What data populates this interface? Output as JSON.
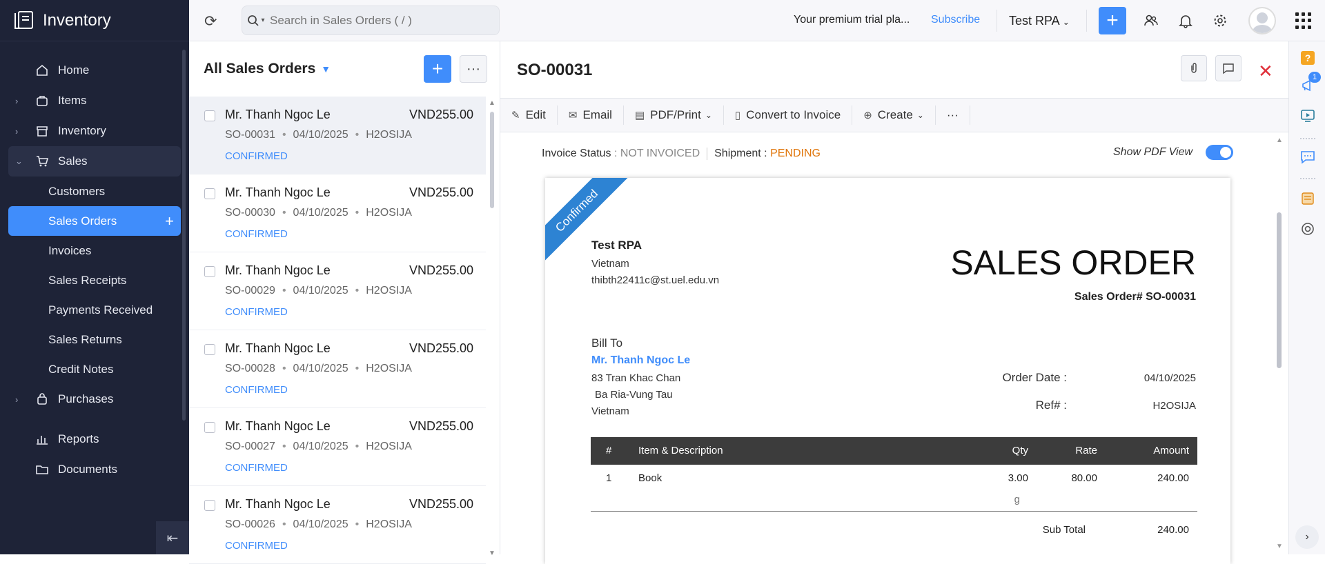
{
  "app": {
    "name": "Inventory"
  },
  "sidebar": {
    "items": [
      {
        "label": "Home"
      },
      {
        "label": "Items"
      },
      {
        "label": "Inventory"
      },
      {
        "label": "Sales"
      },
      {
        "label": "Purchases"
      },
      {
        "label": "Reports"
      },
      {
        "label": "Documents"
      }
    ],
    "sales_sub": [
      {
        "label": "Customers"
      },
      {
        "label": "Sales Orders"
      },
      {
        "label": "Invoices"
      },
      {
        "label": "Sales Receipts"
      },
      {
        "label": "Payments Received"
      },
      {
        "label": "Sales Returns"
      },
      {
        "label": "Credit Notes"
      }
    ]
  },
  "topbar": {
    "search_placeholder": "Search in Sales Orders ( / )",
    "trial_text": "Your premium trial pla...",
    "subscribe": "Subscribe",
    "org": "Test RPA"
  },
  "list": {
    "title": "All Sales Orders",
    "rows": [
      {
        "name": "Mr. Thanh Ngoc Le",
        "amount": "VND255.00",
        "number": "SO-00031",
        "date": "04/10/2025",
        "ref": "H2OSIJA",
        "status": "CONFIRMED"
      },
      {
        "name": "Mr. Thanh Ngoc Le",
        "amount": "VND255.00",
        "number": "SO-00030",
        "date": "04/10/2025",
        "ref": "H2OSIJA",
        "status": "CONFIRMED"
      },
      {
        "name": "Mr. Thanh Ngoc Le",
        "amount": "VND255.00",
        "number": "SO-00029",
        "date": "04/10/2025",
        "ref": "H2OSIJA",
        "status": "CONFIRMED"
      },
      {
        "name": "Mr. Thanh Ngoc Le",
        "amount": "VND255.00",
        "number": "SO-00028",
        "date": "04/10/2025",
        "ref": "H2OSIJA",
        "status": "CONFIRMED"
      },
      {
        "name": "Mr. Thanh Ngoc Le",
        "amount": "VND255.00",
        "number": "SO-00027",
        "date": "04/10/2025",
        "ref": "H2OSIJA",
        "status": "CONFIRMED"
      },
      {
        "name": "Mr. Thanh Ngoc Le",
        "amount": "VND255.00",
        "number": "SO-00026",
        "date": "04/10/2025",
        "ref": "H2OSIJA",
        "status": "CONFIRMED"
      }
    ]
  },
  "detail": {
    "title": "SO-00031",
    "toolbar": {
      "edit": "Edit",
      "email": "Email",
      "pdf": "PDF/Print",
      "convert": "Convert to Invoice",
      "create": "Create"
    },
    "invoice_status_label": "Invoice Status",
    "invoice_status": "NOT INVOICED",
    "shipment_label": "Shipment",
    "shipment_status": "PENDING",
    "show_pdf": "Show PDF View"
  },
  "doc": {
    "ribbon": "Confirmed",
    "org_name": "Test RPA",
    "org_country": "Vietnam",
    "org_email": "thibth22411c@st.uel.edu.vn",
    "title": "SALES ORDER",
    "number_line": "Sales Order# SO-00031",
    "bill_to": "Bill To",
    "customer": "Mr. Thanh Ngoc Le",
    "addr1": "83 Tran Khac Chan",
    "addr2": "Ba Ria-Vung Tau",
    "addr3": "Vietnam",
    "order_date_label": "Order Date :",
    "order_date": "04/10/2025",
    "ref_label": "Ref# :",
    "ref": "H2OSIJA",
    "table_headers": {
      "num": "#",
      "item": "Item & Description",
      "qty": "Qty",
      "rate": "Rate",
      "amount": "Amount"
    },
    "line": {
      "num": "1",
      "item": "Book",
      "qty": "3.00",
      "unit": "g",
      "rate": "80.00",
      "amount": "240.00"
    },
    "subtotal_label": "Sub Total",
    "subtotal": "240.00"
  },
  "rail": {
    "notif_count": "1"
  }
}
